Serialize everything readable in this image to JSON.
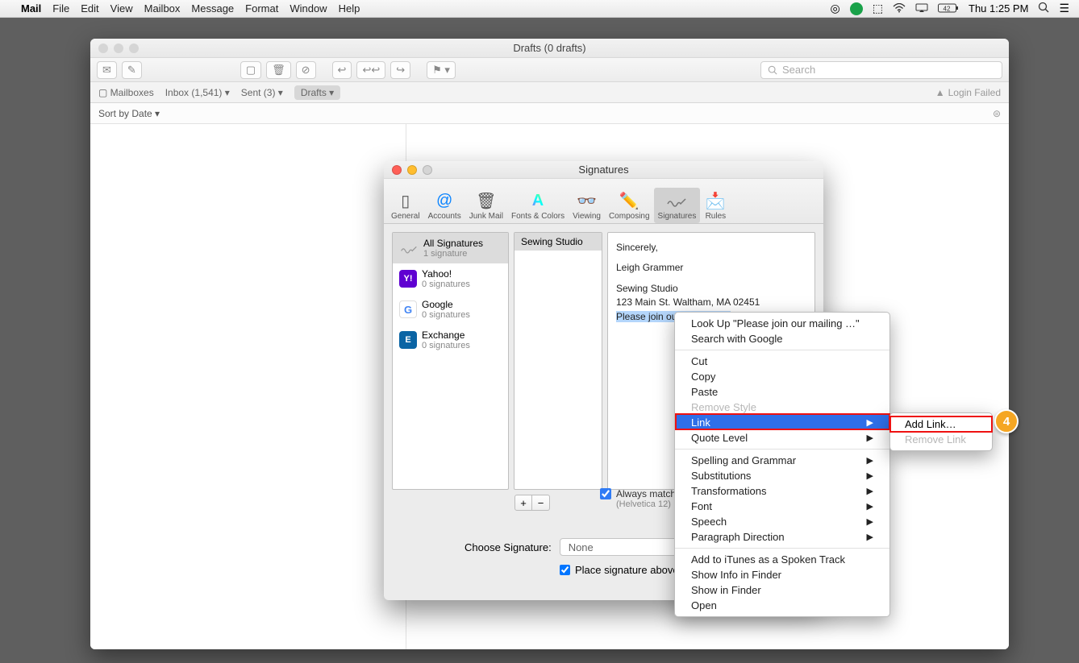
{
  "menubar": {
    "app": "Mail",
    "items": [
      "File",
      "Edit",
      "View",
      "Mailbox",
      "Message",
      "Format",
      "Window",
      "Help"
    ],
    "clock": "Thu 1:25 PM",
    "battery": "42"
  },
  "mailwin": {
    "title": "Drafts (0 drafts)",
    "search_placeholder": "Search",
    "favbar": {
      "mailboxes": "Mailboxes",
      "inbox": "Inbox (1,541)",
      "sent": "Sent (3)",
      "drafts": "Drafts",
      "login_failed": "Login Failed"
    },
    "sort": "Sort by Date"
  },
  "prefwin": {
    "title": "Signatures",
    "tabs": [
      "General",
      "Accounts",
      "Junk Mail",
      "Fonts & Colors",
      "Viewing",
      "Composing",
      "Signatures",
      "Rules"
    ],
    "accounts": [
      {
        "name": "All Signatures",
        "sub": "1 signature"
      },
      {
        "name": "Yahoo!",
        "sub": "0 signatures"
      },
      {
        "name": "Google",
        "sub": "0 signatures"
      },
      {
        "name": "Exchange",
        "sub": "0 signatures"
      }
    ],
    "signame": "Sewing Studio",
    "sig": {
      "l1": "Sincerely,",
      "l2": "Leigh Grammer",
      "l3": "Sewing Studio",
      "l4": "123 Main St. Waltham, MA 02451",
      "l5": "Please join our mailing list!"
    },
    "match_label": "Always match my default message font",
    "match_sub": "(Helvetica 12)",
    "choose_label": "Choose Signature:",
    "choose_value": "None",
    "place_label": "Place signature above quoted text"
  },
  "ctxmenu": {
    "lookup": "Look Up \"Please join our mailing …\"",
    "search_google": "Search with Google",
    "cut": "Cut",
    "copy": "Copy",
    "paste": "Paste",
    "remove_style": "Remove Style",
    "link": "Link",
    "quote_level": "Quote Level",
    "spelling": "Spelling and Grammar",
    "subs": "Substitutions",
    "trans": "Transformations",
    "font": "Font",
    "speech": "Speech",
    "paradir": "Paragraph Direction",
    "itunes": "Add to iTunes as a Spoken Track",
    "showinfo": "Show Info in Finder",
    "showin": "Show in Finder",
    "open": "Open"
  },
  "submenu": {
    "add": "Add Link…",
    "remove": "Remove Link"
  },
  "annotation": {
    "badge": "4"
  }
}
